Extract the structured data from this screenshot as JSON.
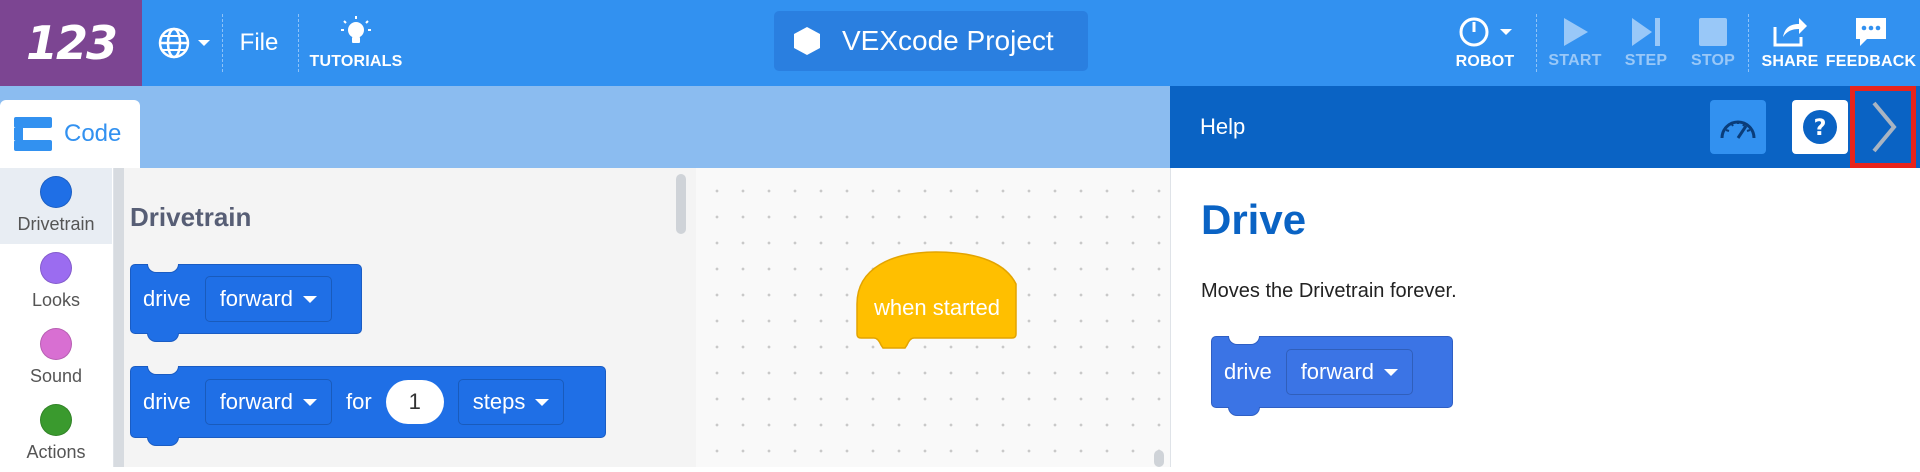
{
  "toolbar": {
    "logo": "123",
    "file_label": "File",
    "tutorials_label": "TUTORIALS",
    "project_title": "VEXcode Project",
    "robot_label": "ROBOT",
    "start_label": "START",
    "step_label": "STEP",
    "stop_label": "STOP",
    "share_label": "SHARE",
    "feedback_label": "FEEDBACK"
  },
  "code_tab": {
    "label": "Code"
  },
  "categories": [
    {
      "label": "Drivetrain",
      "color": "#1f6fe6"
    },
    {
      "label": "Looks",
      "color": "#9b6cf0"
    },
    {
      "label": "Sound",
      "color": "#d86fd2"
    },
    {
      "label": "Actions",
      "color": "#3a9a2e"
    }
  ],
  "flyout": {
    "title": "Drivetrain",
    "block1": {
      "keyword": "drive",
      "direction": "forward"
    },
    "block2": {
      "keyword": "drive",
      "direction": "forward",
      "for": "for",
      "amount": "1",
      "unit": "steps"
    }
  },
  "workspace": {
    "hat_label": "when started"
  },
  "help": {
    "title": "Help",
    "heading": "Drive",
    "description": "Moves the Drivetrain forever.",
    "block": {
      "keyword": "drive",
      "direction": "forward"
    }
  },
  "colors": {
    "toolbar": "#3291f0",
    "logo_bg": "#7c4592",
    "drivetrain_block": "#1f6fe6",
    "event_block": "#ffbf00",
    "help_header": "#0a63c4",
    "highlight_border": "#e8241c"
  }
}
